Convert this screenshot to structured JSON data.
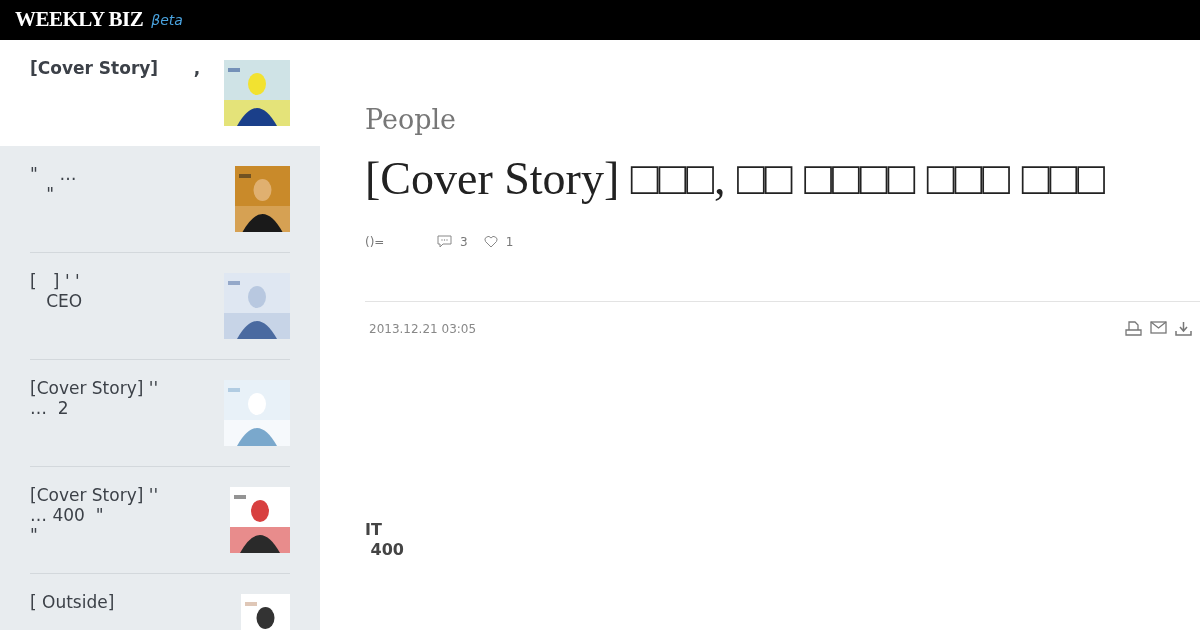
{
  "header": {
    "logo": "WEEKLY BIZ",
    "badge": "βeta"
  },
  "sidebar": {
    "items": [
      {
        "title": "[Cover Story]      ,",
        "selected": true
      },
      {
        "title": "\"    …\n   \"",
        "selected": false
      },
      {
        "title": "[   ] ' '\n   CEO",
        "selected": false
      },
      {
        "title": "[Cover Story] ''\n…  2",
        "selected": false
      },
      {
        "title": "[Cover Story] ''\n… 400  \"\n\"",
        "selected": false
      },
      {
        "title": "[ Outside]",
        "selected": false
      }
    ]
  },
  "article": {
    "section": "People",
    "title": "[Cover Story] □□□, □□ □□□□ □□□ □□□",
    "byline": "()=",
    "comments": "3",
    "likes": "1",
    "date": "2013.12.21 03:05",
    "body": "IT\n 400"
  }
}
